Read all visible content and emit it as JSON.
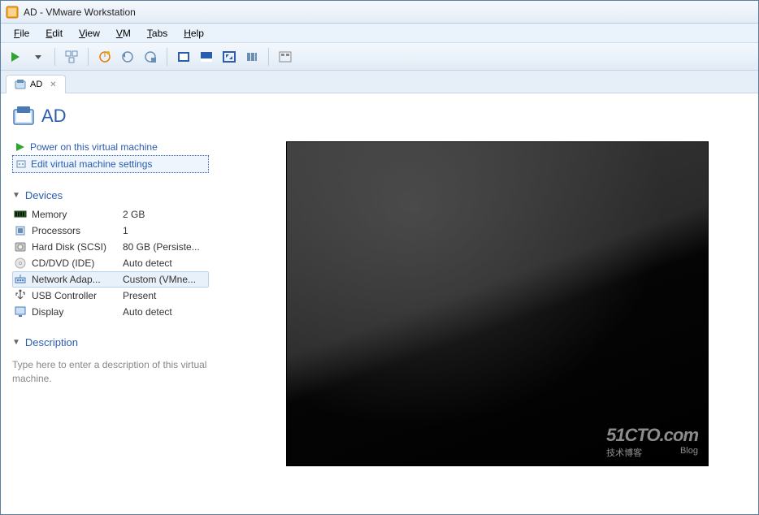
{
  "window": {
    "title": "AD - VMware Workstation"
  },
  "menu": {
    "file": "File",
    "edit": "Edit",
    "view": "View",
    "vm": "VM",
    "tabs": "Tabs",
    "help": "Help"
  },
  "tab": {
    "label": "AD"
  },
  "vm": {
    "name": "AD",
    "actions": {
      "power_on": "Power on this virtual machine",
      "edit_settings": "Edit virtual machine settings"
    }
  },
  "sections": {
    "devices": "Devices",
    "description": "Description"
  },
  "devices": [
    {
      "icon": "memory-icon",
      "name": "Memory",
      "value": "2 GB"
    },
    {
      "icon": "cpu-icon",
      "name": "Processors",
      "value": "1"
    },
    {
      "icon": "disk-icon",
      "name": "Hard Disk (SCSI)",
      "value": "80 GB (Persiste..."
    },
    {
      "icon": "cd-icon",
      "name": "CD/DVD (IDE)",
      "value": "Auto detect"
    },
    {
      "icon": "network-icon",
      "name": "Network Adap...",
      "value": "Custom (VMne...",
      "selected": true
    },
    {
      "icon": "usb-icon",
      "name": "USB Controller",
      "value": "Present"
    },
    {
      "icon": "display-icon",
      "name": "Display",
      "value": "Auto detect"
    }
  ],
  "description_placeholder": "Type here to enter a description of this virtual machine.",
  "watermark": {
    "big": "51CTO.com",
    "sub1": "技术博客",
    "sub2": "Blog"
  }
}
